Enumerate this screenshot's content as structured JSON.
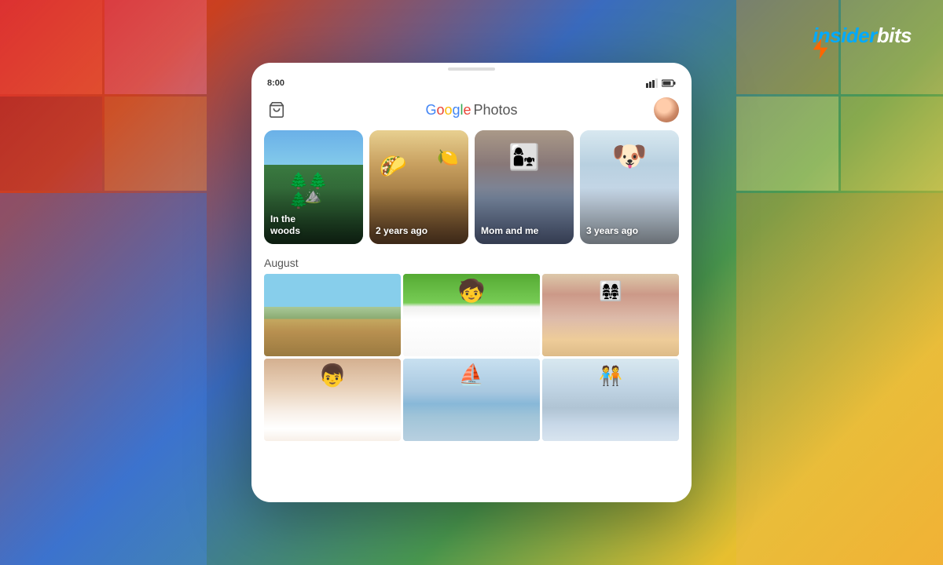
{
  "background": {
    "gradient": "multicolor"
  },
  "logo": {
    "brand": "insiderbits",
    "part1": "insider",
    "part2": "bits"
  },
  "device": {
    "status_bar": {
      "time": "8:00",
      "signal": "▼▲",
      "battery": "■"
    },
    "app_header": {
      "logo_google": "Google",
      "logo_photos": "Photos",
      "google_letters": [
        "G",
        "o",
        "o",
        "g",
        "l",
        "e"
      ]
    },
    "memories": [
      {
        "id": "woods",
        "label": "In the\nwoods",
        "label_line1": "In the",
        "label_line2": "woods"
      },
      {
        "id": "years-ago",
        "label": "2 years ago"
      },
      {
        "id": "mom",
        "label": "Mom and me"
      },
      {
        "id": "dog",
        "label": "3 years ago"
      }
    ],
    "photo_section": {
      "heading": "August"
    },
    "photos_row1": [
      {
        "id": "beach",
        "type": "beach"
      },
      {
        "id": "boy",
        "type": "boy"
      },
      {
        "id": "group",
        "type": "group"
      }
    ],
    "photos_row2": [
      {
        "id": "child",
        "type": "child"
      },
      {
        "id": "sailboat",
        "type": "sailboat"
      },
      {
        "id": "people2",
        "type": "people2"
      }
    ]
  }
}
